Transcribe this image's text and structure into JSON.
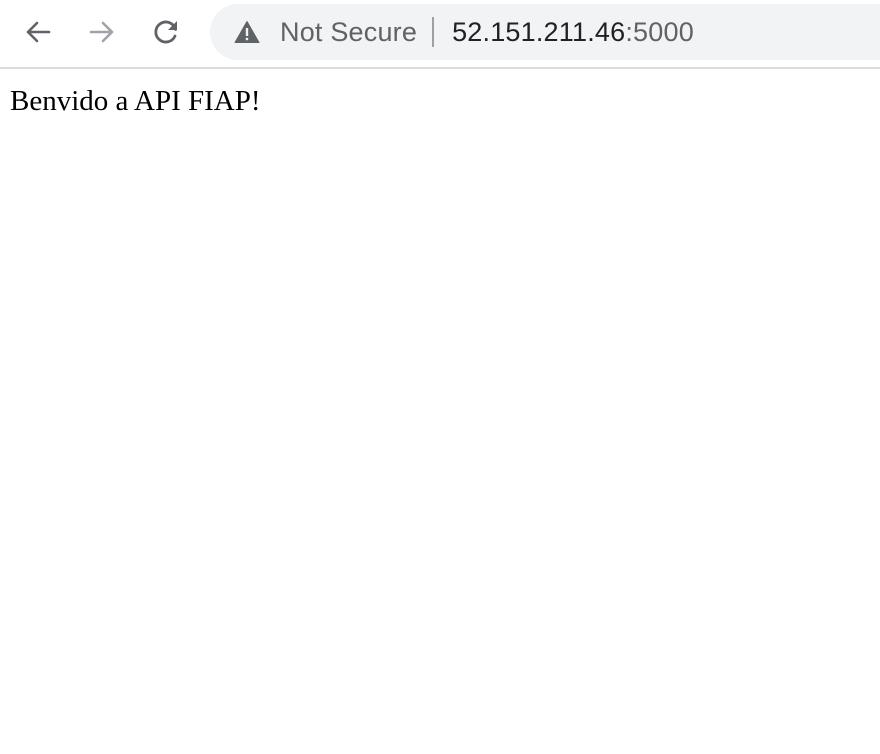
{
  "browser": {
    "nav": {
      "back_icon": "arrow-left-icon",
      "forward_icon": "arrow-right-icon",
      "reload_icon": "reload-icon"
    },
    "omnibox": {
      "security_icon": "warning-triangle-icon",
      "security_label": "Not Secure",
      "url_host": "52.151.211.46",
      "url_port": ":5000"
    },
    "colors": {
      "toolbar_border": "#dadce0",
      "omnibox_bg": "#f1f3f4",
      "icon_active": "#5f6368",
      "icon_disabled": "#a0a4a8"
    }
  },
  "page": {
    "text": "Benvido a API FIAP!"
  }
}
